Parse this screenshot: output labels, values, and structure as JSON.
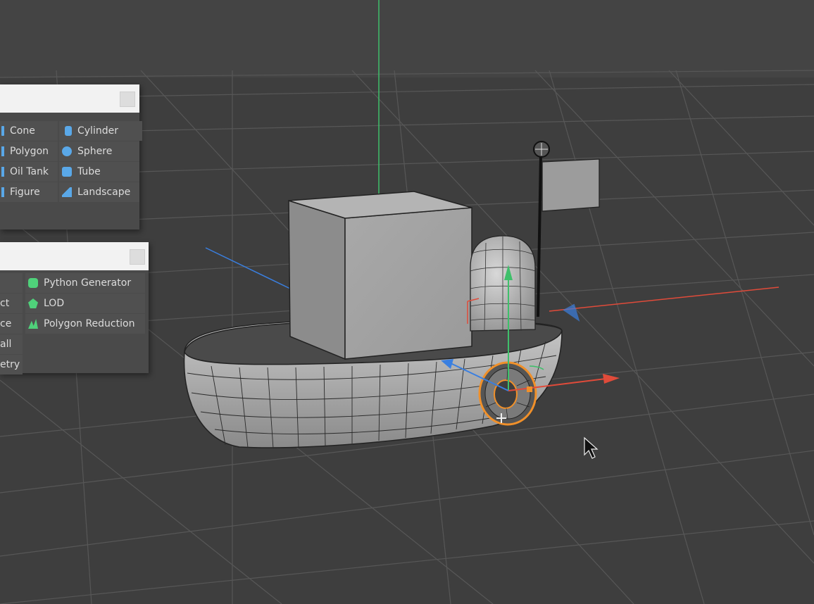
{
  "primitive_panel": {
    "items": [
      {
        "label": "Cone",
        "icon": "cone-icon"
      },
      {
        "label": "Cylinder",
        "icon": "cylinder-icon"
      },
      {
        "label": "Polygon",
        "icon": "polygon-icon"
      },
      {
        "label": "Sphere",
        "icon": "sphere-icon"
      },
      {
        "label": "Oil Tank",
        "icon": "oil-tank-icon"
      },
      {
        "label": "Tube",
        "icon": "tube-icon"
      },
      {
        "label": "Figure",
        "icon": "figure-icon"
      },
      {
        "label": "Landscape",
        "icon": "landscape-icon"
      }
    ]
  },
  "generator_panel": {
    "items": [
      {
        "label": "Python Generator",
        "icon": "python-icon"
      },
      {
        "label": "ct",
        "icon": ""
      },
      {
        "label": "LOD",
        "icon": "lod-icon"
      },
      {
        "label": "ce",
        "icon": ""
      },
      {
        "label": "Polygon Reduction",
        "icon": "polygon-reduction-icon"
      },
      {
        "label": "all",
        "icon": ""
      },
      {
        "label": "etry",
        "icon": ""
      }
    ]
  },
  "colors": {
    "background": "#3e3e3e",
    "grid": "#5a5a5a",
    "axis_x": "#e04b3a",
    "axis_y": "#3fbf6a",
    "axis_z": "#3a7fe0",
    "selection": "#f0902a",
    "icon_blue": "#5aa8e8",
    "icon_green": "#4fd17a"
  }
}
